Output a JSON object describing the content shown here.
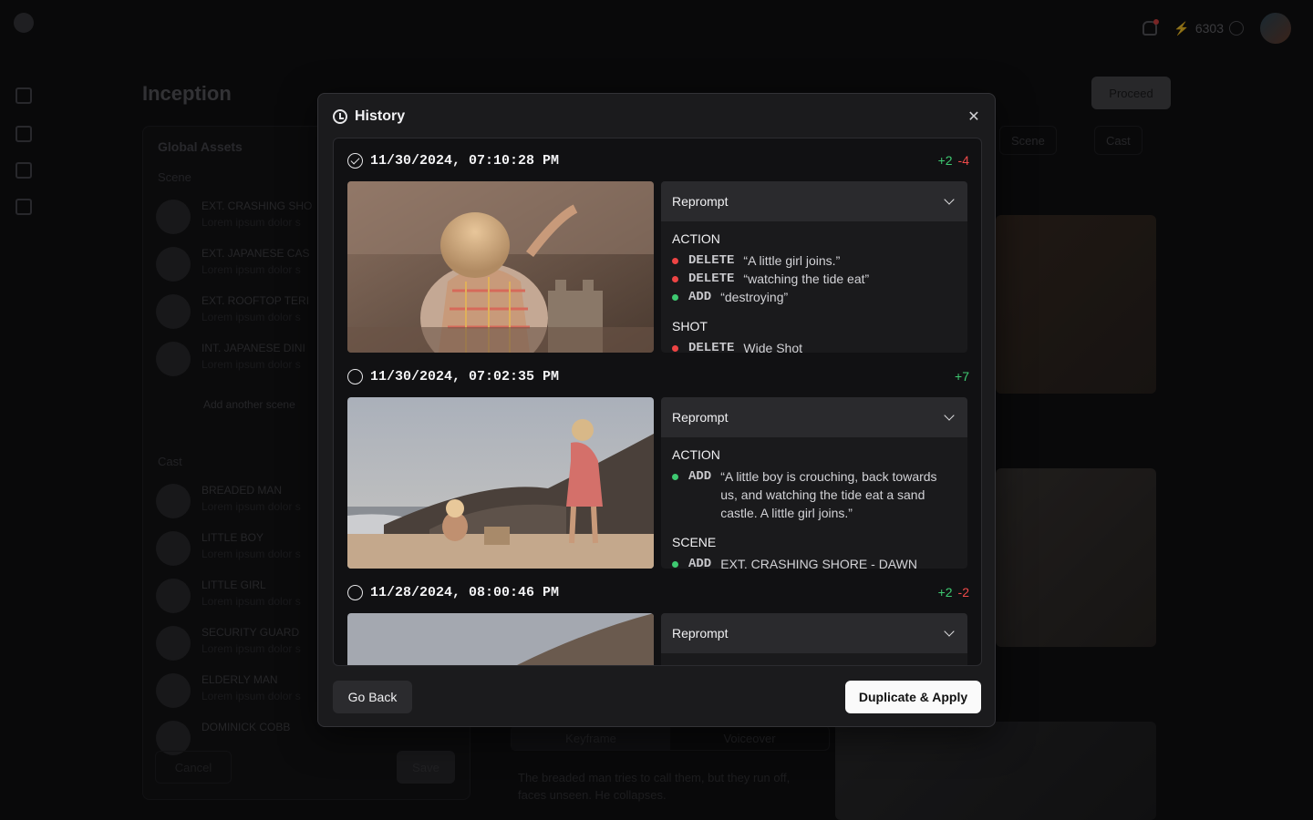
{
  "background": {
    "project_title": "Inception",
    "proceed_label": "Proceed",
    "credits": "6303",
    "global_assets_title": "Global Assets",
    "scene_section": "Scene",
    "scenes": [
      {
        "name": "EXT. CRASHING SHO",
        "desc": "Lorem ipsum dolor s"
      },
      {
        "name": "EXT. JAPANESE CAS",
        "desc": "Lorem ipsum dolor s"
      },
      {
        "name": "EXT. ROOFTOP TERI",
        "desc": "Lorem ipsum dolor s"
      },
      {
        "name": "INT. JAPANESE DINI",
        "desc": "Lorem ipsum dolor s"
      }
    ],
    "add_scene_label": "Add another scene",
    "cast_section": "Cast",
    "cast": [
      {
        "name": "BREADED MAN",
        "desc": "Lorem ipsum dolor s"
      },
      {
        "name": "LITTLE BOY",
        "desc": "Lorem ipsum dolor s"
      },
      {
        "name": "LITTLE GIRL",
        "desc": "Lorem ipsum dolor s"
      },
      {
        "name": "SECURITY GUARD",
        "desc": "Lorem ipsum dolor s"
      },
      {
        "name": "ELDERLY MAN",
        "desc": "Lorem ipsum dolor s"
      },
      {
        "name": "DOMINICK COBB",
        "desc": ""
      }
    ],
    "cancel_label": "Cancel",
    "save_label": "Save",
    "scene_pill": "Scene",
    "cast_pill": "Cast",
    "tab_keyframe": "Keyframe",
    "tab_voiceover": "Voiceover",
    "shot_text": "The breaded man tries to call them, but they run off, faces unseen. He collapses."
  },
  "modal": {
    "title": "History",
    "go_back_label": "Go Back",
    "apply_label": "Duplicate & Apply",
    "entries": [
      {
        "timestamp": "11/30/2024, 07:10:28 PM",
        "selected": true,
        "additions": "+2",
        "deletions": "-4",
        "mode": "Reprompt",
        "sections": [
          {
            "title": "ACTION",
            "changes": [
              {
                "op": "DELETE",
                "text": "“A little girl joins.”"
              },
              {
                "op": "DELETE",
                "text": "“watching the tide eat”"
              },
              {
                "op": "ADD",
                "text": "“destroying”"
              }
            ]
          },
          {
            "title": "SHOT",
            "changes": [
              {
                "op": "DELETE",
                "text": "Wide Shot"
              }
            ]
          }
        ]
      },
      {
        "timestamp": "11/30/2024, 07:02:35 PM",
        "selected": false,
        "additions": "+7",
        "deletions": "",
        "mode": "Reprompt",
        "sections": [
          {
            "title": "ACTION",
            "changes": [
              {
                "op": "ADD",
                "text": "“A little boy is crouching, back towards us, and watching the tide eat a sand castle. A little girl joins.”"
              }
            ]
          },
          {
            "title": "SCENE",
            "changes": [
              {
                "op": "ADD",
                "text": "EXT. CRASHING SHORE - DAWN"
              }
            ]
          }
        ]
      },
      {
        "timestamp": "11/28/2024, 08:00:46 PM",
        "selected": false,
        "additions": "+2",
        "deletions": "-2",
        "mode": "Reprompt",
        "sections": []
      }
    ]
  },
  "colors": {
    "add": "#3ec971",
    "delete": "#ef4a4a",
    "primary_button": "#fafafa"
  }
}
